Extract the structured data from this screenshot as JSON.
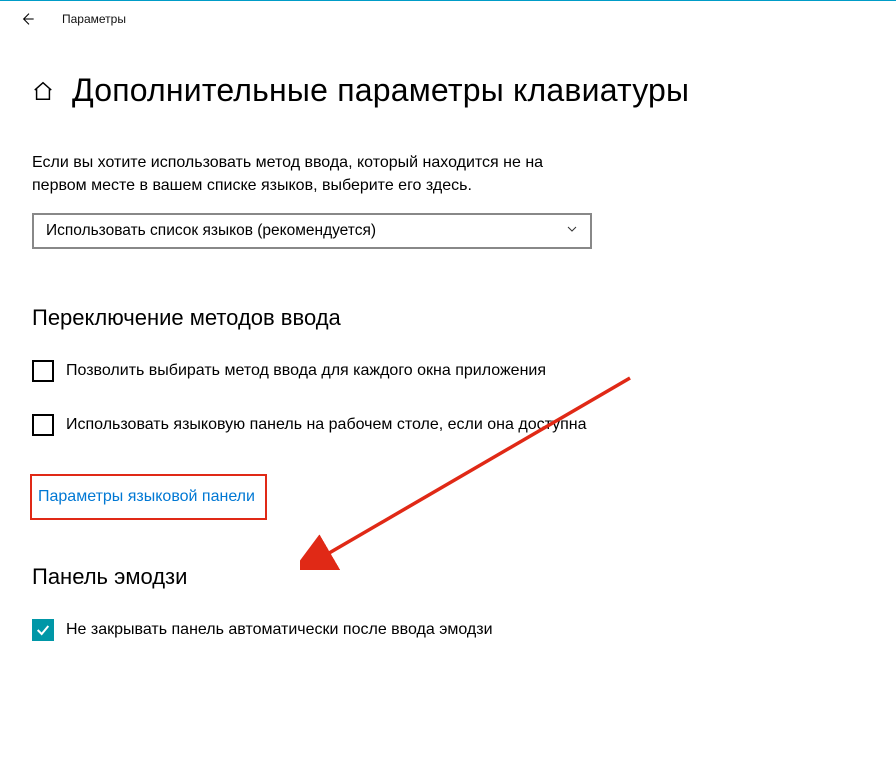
{
  "window": {
    "title": "Параметры"
  },
  "page": {
    "title": "Дополнительные параметры клавиатуры"
  },
  "intro": {
    "text": "Если вы хотите использовать метод ввода, который находится не на первом месте в вашем списке языков, выберите его здесь."
  },
  "dropdown": {
    "selected": "Использовать список языков (рекомендуется)"
  },
  "sections": {
    "switching": {
      "heading": "Переключение методов ввода",
      "checkbox1": "Позволить выбирать метод ввода для каждого окна приложения",
      "checkbox2": "Использовать языковую панель на рабочем столе, если она доступна",
      "link": "Параметры языковой панели"
    },
    "emoji": {
      "heading": "Панель эмодзи",
      "checkbox1": "Не закрывать панель автоматически после ввода эмодзи"
    }
  }
}
